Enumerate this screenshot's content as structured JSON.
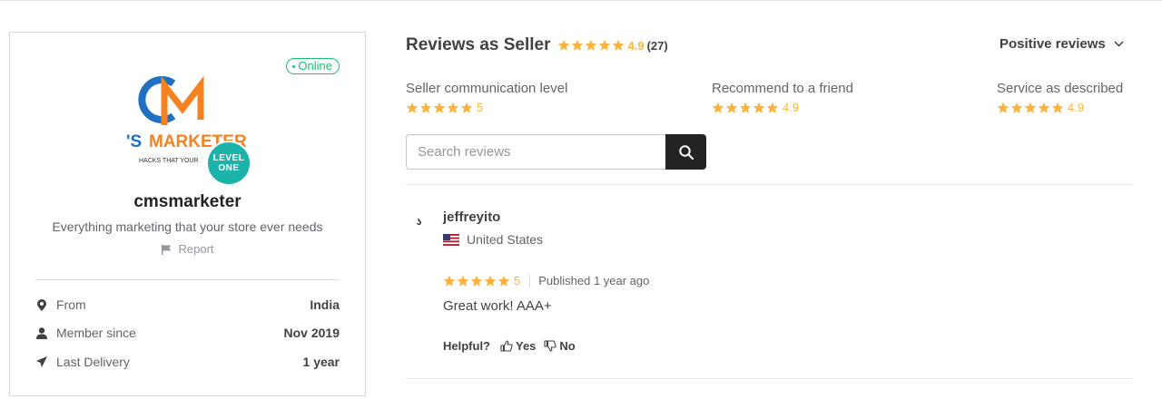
{
  "seller": {
    "status_badge": "Online",
    "logo": {
      "text": "'S MARKETER",
      "tagline": "HACKS THAT YOUR",
      "colors": {
        "blue": "#1f6fc2",
        "orange": "#f58220"
      }
    },
    "level_badge": {
      "line1": "LEVEL",
      "line2": "ONE",
      "color": "#1cb4aa"
    },
    "name": "cmsmarketer",
    "tagline": "Everything marketing that your store ever needs",
    "report_label": "Report",
    "stats": [
      {
        "icon": "location-pin-icon",
        "label": "From",
        "value": "India"
      },
      {
        "icon": "user-icon",
        "label": "Member since",
        "value": "Nov 2019"
      },
      {
        "icon": "paper-plane-icon",
        "label": "Last Delivery",
        "value": "1 year"
      }
    ]
  },
  "reviews": {
    "title": "Reviews as Seller",
    "rating": "4.9",
    "count": "(27)",
    "sort_label": "Positive reviews",
    "subratings": [
      {
        "label": "Seller communication level",
        "value": "5"
      },
      {
        "label": "Recommend to a friend",
        "value": "4.9"
      },
      {
        "label": "Service as described",
        "value": "4.9"
      }
    ],
    "search": {
      "placeholder": "Search reviews"
    },
    "items": [
      {
        "avatar_mark": "ʖ",
        "user": "jeffreyito",
        "country": "United States",
        "rating": "5",
        "published": "Published 1 year ago",
        "body": "Great work! AAA+",
        "helpful_label": "Helpful?",
        "yes_label": "Yes",
        "no_label": "No"
      }
    ]
  },
  "colors": {
    "star": "#ffb33e",
    "online": "#1dbf73",
    "text": "#404145",
    "muted": "#62646a"
  }
}
